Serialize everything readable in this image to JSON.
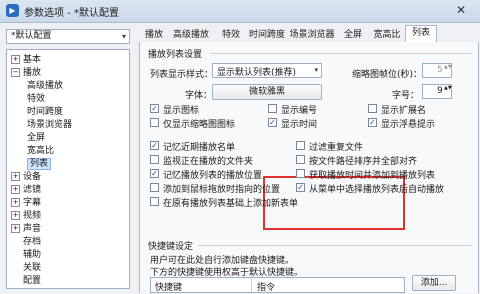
{
  "window": {
    "title": "参数选项 - *默认配置",
    "close_glyph": "✕",
    "app_glyph": "▶"
  },
  "preset": {
    "value": "*默认配置",
    "arrow": "▾"
  },
  "tree": [
    {
      "label": "基本",
      "pm": "+",
      "indent": 0
    },
    {
      "label": "播放",
      "pm": "−",
      "indent": 0
    },
    {
      "label": "高级播放",
      "pm": "",
      "indent": 1
    },
    {
      "label": "特效",
      "pm": "",
      "indent": 1
    },
    {
      "label": "时间跨度",
      "pm": "",
      "indent": 1
    },
    {
      "label": "场景浏览器",
      "pm": "",
      "indent": 1
    },
    {
      "label": "全屏",
      "pm": "",
      "indent": 1
    },
    {
      "label": "宽高比",
      "pm": "",
      "indent": 1
    },
    {
      "label": "列表",
      "pm": "",
      "indent": 1,
      "selected": true
    },
    {
      "label": "设备",
      "pm": "+",
      "indent": 0
    },
    {
      "label": "滤镜",
      "pm": "+",
      "indent": 0
    },
    {
      "label": "字幕",
      "pm": "+",
      "indent": 0
    },
    {
      "label": "视频",
      "pm": "+",
      "indent": 0
    },
    {
      "label": "声音",
      "pm": "+",
      "indent": 0
    },
    {
      "label": "存档",
      "pm": "",
      "indent": 0
    },
    {
      "label": "辅助",
      "pm": "",
      "indent": 0
    },
    {
      "label": "关联",
      "pm": "",
      "indent": 0
    },
    {
      "label": "配置",
      "pm": "",
      "indent": 0
    }
  ],
  "tabs": [
    "播放",
    "高级播放",
    "特效",
    "时间跨度",
    "场景浏览器",
    "全屏",
    "宽高比",
    "列表"
  ],
  "panel": {
    "section1": "播放列表设置",
    "display_style_label": "列表显示样式：",
    "display_style_value": "显示默认列表(推荐)",
    "thumb_width_label": "缩略图帧位(秒)：",
    "thumb_width_value": "5",
    "font_label": "字体：",
    "font_button": "微软雅黑",
    "font_size_label": "字号：",
    "font_size_value": "9",
    "checks": [
      {
        "label": "显示图标",
        "checked": true
      },
      {
        "label": "显示编号",
        "checked": false
      },
      {
        "label": "显示扩展名",
        "checked": false
      },
      {
        "label": "仅显示缩略图图标",
        "checked": false
      },
      {
        "label": "显示时间",
        "checked": true
      },
      {
        "label": "显示浮悬提示",
        "checked": true
      },
      {
        "label": "记忆近期播放名单",
        "checked": true
      },
      {
        "label": "过滤重复文件",
        "checked": false
      },
      {
        "label": "监视正在播放的文件夹",
        "checked": false
      },
      {
        "label": "按文件路径排序并全部对齐",
        "checked": false
      },
      {
        "label": "记忆播放列表的播放位置",
        "checked": true
      },
      {
        "label": "获取播放时间并添加到播放列表",
        "checked": false
      },
      {
        "label": "添加到鼠标拖放时指向的位置",
        "checked": false
      },
      {
        "label": "从菜单中选择播放列表后自动播放",
        "checked": true
      },
      {
        "label": "在原有播放列表基础上添加新表单",
        "checked": false
      }
    ],
    "section2": "快捷键设定",
    "hotkey_desc1": "用户可在此处自行添加键盘快捷键。",
    "hotkey_desc2": "下方的快捷键使用权高于默认快捷键。",
    "table_headers": [
      "快捷键",
      "指令"
    ],
    "add_button": "添加...",
    "spin": "▲▼",
    "dd": "▾",
    "checkmark": "✓"
  }
}
